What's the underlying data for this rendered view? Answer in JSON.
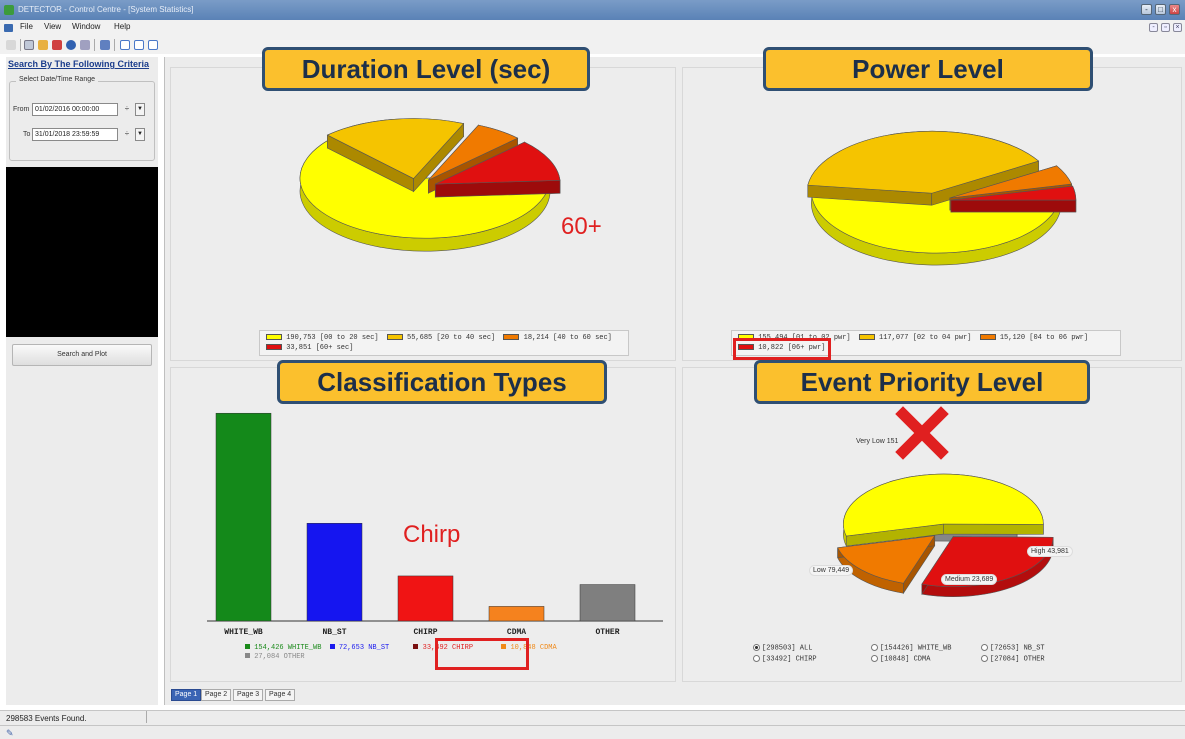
{
  "window": {
    "title": "DETECTOR - Control Centre - [System Statistics]",
    "controls": [
      "-",
      "□",
      "x"
    ]
  },
  "menu": [
    "File",
    "View",
    "Window",
    "Help"
  ],
  "sidebar": {
    "title": "Search By The Following Criteria",
    "group_label": "Select Date/Time Range",
    "from_label": "From",
    "from_value": "01/02/2016  00:00:00",
    "to_label": "To",
    "to_value": "31/01/2018  23:59:59",
    "search_button": "Search and Plot"
  },
  "panels": {
    "duration": {
      "banner": "Duration Level (sec)",
      "annotation": "60+",
      "legend": [
        {
          "value": "190,753",
          "label": "[00 to 20 sec]",
          "color": "#ffff00"
        },
        {
          "value": "55,685",
          "label": "[20 to 40 sec]",
          "color": "#f5c400"
        },
        {
          "value": "18,214",
          "label": "[40 to 60 sec]",
          "color": "#f07a00"
        },
        {
          "value": "33,851",
          "label": "[60+ sec]",
          "color": "#e01010"
        }
      ],
      "legend_line1": "190,753 [00 to 20 sec]",
      "legend_line1b": "55,685 [20 to 40 sec]",
      "legend_line1c": "18,214 [40 to 60 sec]",
      "legend_line2": "33,851 [60+ sec]"
    },
    "power": {
      "banner": "Power Level",
      "legend": [
        {
          "value": "155,494",
          "label": "[01 to 02 pwr]",
          "color": "#ffff00"
        },
        {
          "value": "117,077",
          "label": "[02 to 04 pwr]",
          "color": "#f5c400"
        },
        {
          "value": "15,120",
          "label": "[04 to 06 pwr]",
          "color": "#f07a00"
        },
        {
          "value": "10,822",
          "label": "[06+ pwr]",
          "color": "#e01010"
        }
      ],
      "legend_line1": "155,494 [01 to 02 pwr]",
      "legend_line1b": "117,077 [02 to 04 pwr]",
      "legend_line1c": "15,120 [04 to 06 pwr]",
      "legend_line2": "10,822 [06+ pwr]"
    },
    "classification": {
      "banner": "Classification Types",
      "annotation": "Chirp",
      "legend_items": [
        {
          "text": "154,426 WHITE_WB",
          "color": "#1a8a1a"
        },
        {
          "text": "72,653 NB_ST",
          "color": "#1a1aee"
        },
        {
          "text": "33,492 CHIRP",
          "color": "#e02020"
        },
        {
          "text": "10,848 CDMA",
          "color": "#f08a1a"
        },
        {
          "text": "27,084 OTHER",
          "color": "#888888"
        }
      ]
    },
    "priority": {
      "banner": "Event Priority Level",
      "labels": {
        "very_low": "Very Low 151",
        "high": "High 43,981",
        "low": "Low 79,449",
        "medium": "Medium 23,689"
      },
      "radios": [
        {
          "label": "[298503] ALL",
          "checked": true
        },
        {
          "label": "[154426] WHITE_WB",
          "checked": false
        },
        {
          "label": "[72653] NB_ST",
          "checked": false
        },
        {
          "label": "[33492] CHIRP",
          "checked": false
        },
        {
          "label": "[10848] CDMA",
          "checked": false
        },
        {
          "label": "[27084] OTHER",
          "checked": false
        }
      ]
    }
  },
  "page_tabs": [
    "Page 1",
    "Page 2",
    "Page 3",
    "Page 4"
  ],
  "status": {
    "events_found": "298583 Events Found."
  },
  "chart_data": [
    {
      "type": "pie",
      "title": "Duration Level (sec)",
      "categories": [
        "[00 to 20 sec]",
        "[20 to 40 sec]",
        "[40 to 60 sec]",
        "[60+ sec]"
      ],
      "values": [
        190753,
        55685,
        18214,
        33851
      ],
      "colors": [
        "#ffff00",
        "#f5c400",
        "#f07a00",
        "#e01010"
      ]
    },
    {
      "type": "pie",
      "title": "Power Level",
      "categories": [
        "[01 to 02 pwr]",
        "[02 to 04 pwr]",
        "[04 to 06 pwr]",
        "[06+ pwr]"
      ],
      "values": [
        155494,
        117077,
        15120,
        10822
      ],
      "colors": [
        "#ffff00",
        "#f5c400",
        "#f07a00",
        "#e01010"
      ]
    },
    {
      "type": "bar",
      "title": "Classification Types",
      "categories": [
        "WHITE_WB",
        "NB_ST",
        "CHIRP",
        "CDMA",
        "OTHER"
      ],
      "values": [
        154426,
        72653,
        33492,
        10848,
        27084
      ],
      "colors": [
        "#14891a",
        "#1515f0",
        "#f01414",
        "#f5821e",
        "#7f7f7f"
      ],
      "ylim": [
        0,
        165000
      ]
    },
    {
      "type": "pie",
      "title": "Event Priority Level",
      "categories": [
        "Very Low",
        "High",
        "Medium",
        "Low"
      ],
      "values": [
        151,
        43981,
        23689,
        79449
      ],
      "colors": [
        "#c0c0c0",
        "#e01010",
        "#f07a00",
        "#ffff00"
      ]
    }
  ]
}
